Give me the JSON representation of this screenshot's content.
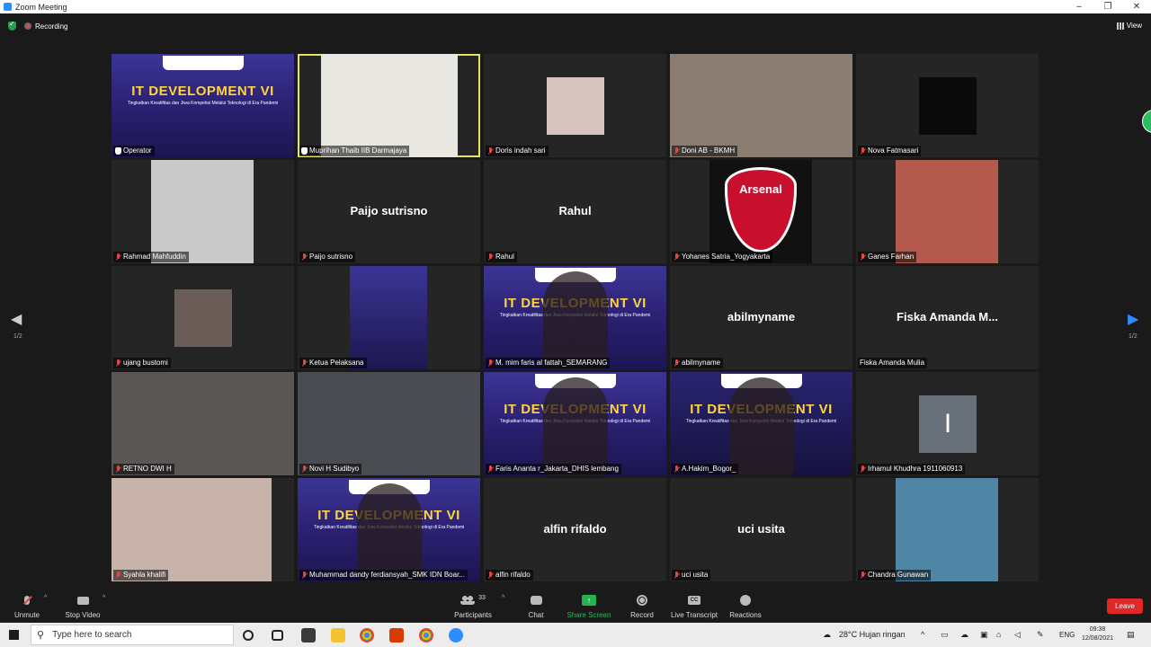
{
  "window": {
    "title": "Zoom Meeting"
  },
  "top": {
    "recording_label": "Recording",
    "view_label": "View"
  },
  "nav": {
    "page_left": "1/2",
    "page_right": "1/2"
  },
  "tiles": [
    {
      "name": "Operator",
      "type": "itdev",
      "mic": "hand"
    },
    {
      "name": "Muprihan Thaib IIB Darmajaya",
      "type": "video",
      "color": "#e9e7e2",
      "active": true,
      "mic": "hand"
    },
    {
      "name": "Doris indah sari",
      "type": "photo",
      "color": "#d9c5bf",
      "mic": "off"
    },
    {
      "name": "Doni AB - BKMH",
      "type": "video",
      "color": "#8b7d72",
      "mic": "off"
    },
    {
      "name": "Nova Fatmasari",
      "type": "photo",
      "color": "#0a0a0a",
      "mic": "off"
    },
    {
      "name": "Rahmad Mahfuddin",
      "type": "photo",
      "color": "#c9c9c9",
      "mic": "off"
    },
    {
      "name": "Paijo sutrisno",
      "type": "name",
      "mic": "off"
    },
    {
      "name": "Rahul",
      "type": "name",
      "mic": "off"
    },
    {
      "name": "Yohanes Satria_Yogyakarta",
      "type": "arsenal",
      "brand": "Arsenal",
      "mic": "off"
    },
    {
      "name": "Ganes Farhan",
      "type": "photo",
      "color": "#b45a4c",
      "mic": "off"
    },
    {
      "name": "ujang bustomi",
      "type": "photo",
      "color": "#6b5e58",
      "mic": "off"
    },
    {
      "name": "Ketua Pelaksana",
      "type": "itdev-small",
      "mic": "off"
    },
    {
      "name": "M. mim faris al fattah_SEMARANG",
      "type": "itdev",
      "mic": "off"
    },
    {
      "name": "abilmyname",
      "type": "name",
      "mic": "off"
    },
    {
      "name": "Fiska Amanda M...",
      "full": "Fiska Amanda Mulia",
      "type": "name",
      "mic": "none"
    },
    {
      "name": "RETNO DWI H",
      "type": "video",
      "color": "#5a5654",
      "mic": "off"
    },
    {
      "name": "Novi H Sudibyo",
      "type": "video",
      "color": "#4a4c52",
      "mic": "off"
    },
    {
      "name": "Faris Ananta r_Jakarta_DHIS lembang",
      "type": "itdev",
      "mic": "off"
    },
    {
      "name": "A.Hakim_Bogor_",
      "type": "itdev-dark",
      "mic": "off"
    },
    {
      "name": "Irhamul Khudhra 1911060913",
      "type": "initial",
      "initial": "I",
      "mic": "off"
    },
    {
      "name": "Syahla khalifi",
      "type": "video",
      "color": "#c7b3a9",
      "mic": "off"
    },
    {
      "name": "Muhammad dandy ferdiansyah_SMK IDN Boar...",
      "type": "itdev",
      "mic": "off"
    },
    {
      "name": "alfin rifaldo",
      "type": "name",
      "mic": "off"
    },
    {
      "name": "uci usita",
      "type": "name",
      "mic": "off"
    },
    {
      "name": "Chandra Gunawan",
      "type": "photo",
      "color": "#4f86a6",
      "mic": "off"
    }
  ],
  "itdev": {
    "title": "IT DEVELOPMENT VI",
    "subtitle": "Tingkatkan Kreatifitas dan Jiwa Kompetisi Melalui Teknologi di Era Pandemi"
  },
  "toolbar": {
    "unmute": "Unmute",
    "stop_video": "Stop Video",
    "participants": "Participants",
    "participants_count": "33",
    "chat": "Chat",
    "share_screen": "Share Screen",
    "record": "Record",
    "live_transcript": "Live Transcript",
    "reactions": "Reactions",
    "leave": "Leave"
  },
  "taskbar": {
    "search_placeholder": "Type here to search",
    "weather": "28°C  Hujan ringan",
    "language": "ENG",
    "time": "09:38",
    "date": "12/08/2021"
  },
  "colors": {
    "accent_green": "#23b34f",
    "leave_red": "#e02828",
    "active_outline": "#e5e55a"
  }
}
